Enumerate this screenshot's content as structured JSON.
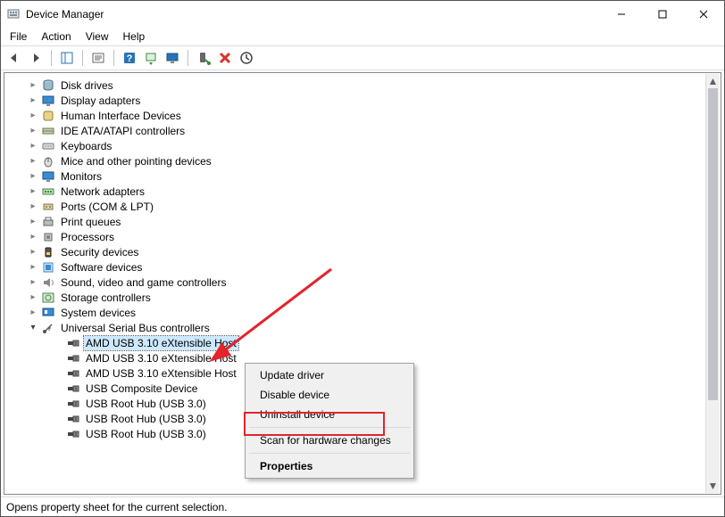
{
  "title": "Device Manager",
  "window_controls": {
    "minimize": "–",
    "maximize": "▢",
    "close": "✕"
  },
  "menu": [
    "File",
    "Action",
    "View",
    "Help"
  ],
  "toolbar_icons": [
    "back-icon",
    "forward-icon",
    "sep",
    "show-hide-tree-icon",
    "sep",
    "properties-icon",
    "sep",
    "help-icon",
    "update-driver-icon",
    "monitor-icon",
    "sep",
    "enable-icon",
    "uninstall-icon",
    "scan-changes-icon"
  ],
  "tree": {
    "categories": [
      {
        "label": "Disk drives",
        "expanded": false,
        "icon": "disk"
      },
      {
        "label": "Display adapters",
        "expanded": false,
        "icon": "display"
      },
      {
        "label": "Human Interface Devices",
        "expanded": false,
        "icon": "hid"
      },
      {
        "label": "IDE ATA/ATAPI controllers",
        "expanded": false,
        "icon": "ide"
      },
      {
        "label": "Keyboards",
        "expanded": false,
        "icon": "keyboard"
      },
      {
        "label": "Mice and other pointing devices",
        "expanded": false,
        "icon": "mouse"
      },
      {
        "label": "Monitors",
        "expanded": false,
        "icon": "monitor"
      },
      {
        "label": "Network adapters",
        "expanded": false,
        "icon": "network"
      },
      {
        "label": "Ports (COM & LPT)",
        "expanded": false,
        "icon": "port"
      },
      {
        "label": "Print queues",
        "expanded": false,
        "icon": "printer"
      },
      {
        "label": "Processors",
        "expanded": false,
        "icon": "cpu"
      },
      {
        "label": "Security devices",
        "expanded": false,
        "icon": "security"
      },
      {
        "label": "Software devices",
        "expanded": false,
        "icon": "software"
      },
      {
        "label": "Sound, video and game controllers",
        "expanded": false,
        "icon": "sound"
      },
      {
        "label": "Storage controllers",
        "expanded": false,
        "icon": "storage"
      },
      {
        "label": "System devices",
        "expanded": false,
        "icon": "system"
      },
      {
        "label": "Universal Serial Bus controllers",
        "expanded": true,
        "icon": "usb",
        "children": [
          {
            "label": "AMD USB 3.10 eXtensible Host",
            "icon": "usb-plug",
            "selected": true,
            "truncated": true
          },
          {
            "label": "AMD USB 3.10 eXtensible Host",
            "icon": "usb-plug",
            "truncated": true
          },
          {
            "label": "AMD USB 3.10 eXtensible Host",
            "icon": "usb-plug",
            "truncated": true
          },
          {
            "label": "USB Composite Device",
            "icon": "usb-plug"
          },
          {
            "label": "USB Root Hub (USB 3.0)",
            "icon": "usb-plug"
          },
          {
            "label": "USB Root Hub (USB 3.0)",
            "icon": "usb-plug"
          },
          {
            "label": "USB Root Hub (USB 3.0)",
            "icon": "usb-plug"
          }
        ]
      }
    ]
  },
  "context_menu": {
    "items": [
      {
        "label": "Update driver"
      },
      {
        "label": "Disable device"
      },
      {
        "label": "Uninstall device",
        "highlighted": true
      },
      {
        "sep": true
      },
      {
        "label": "Scan for hardware changes"
      },
      {
        "sep": true
      },
      {
        "label": "Properties",
        "bold": true
      }
    ]
  },
  "status": "Opens property sheet for the current selection."
}
